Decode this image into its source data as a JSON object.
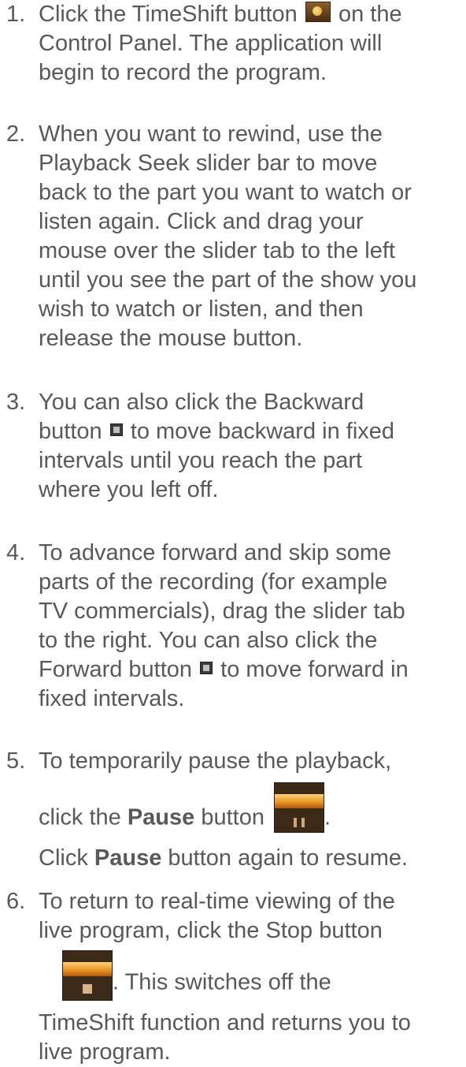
{
  "steps": [
    {
      "number": "1.",
      "lines": [
        [
          "Click the TimeShift button",
          "on the"
        ],
        "Control Panel. The application will",
        "begin to record the program."
      ],
      "icon": "timeshift-icon"
    },
    {
      "number": "2.",
      "lines": [
        "When you want to rewind, use the",
        "Playback Seek slider bar to move",
        "back to the part you want to watch or",
        "listen again. Click and drag your",
        "mouse over the slider tab to the left",
        "until you see the part of the show you",
        "wish to watch or listen, and then",
        "release the mouse button."
      ]
    },
    {
      "number": "3.",
      "lines": [
        [
          "You can also click the Backward"
        ],
        [
          "button",
          "to move backward in fixed"
        ],
        "intervals until you reach the part",
        "where you left off."
      ],
      "icon": "backward-icon"
    },
    {
      "number": "4.",
      "lines": [
        "To advance forward and skip some",
        "parts of the recording (for example",
        "TV commercials), drag the slider tab",
        "to the right. You can also click the",
        [
          "Forward button",
          "to move forward in"
        ],
        "fixed intervals."
      ],
      "icon": "forward-icon"
    },
    {
      "number": "5.",
      "lines": [
        "To temporarily pause the playback,",
        [
          "click the ",
          "Pause",
          " button",
          "."
        ],
        [
          "Click ",
          "Pause",
          " button again to resume."
        ]
      ],
      "icon": "pause-icon"
    },
    {
      "number": "6.",
      "lines": [
        "To return to real-time viewing of the",
        "live program, click the Stop button",
        ". This switches off the",
        "TimeShift function and returns you to",
        "live program."
      ],
      "icon": "stop-icon"
    }
  ]
}
